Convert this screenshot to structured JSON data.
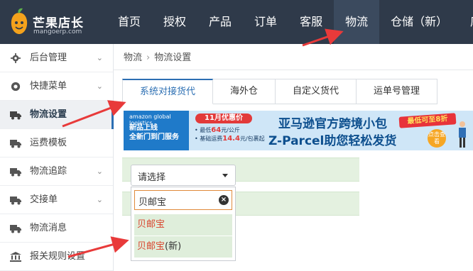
{
  "app": {
    "logo_title": "芒果店长",
    "logo_sub": "mangoerp.com"
  },
  "topnav": {
    "items": [
      {
        "label": "首页"
      },
      {
        "label": "授权"
      },
      {
        "label": "产品"
      },
      {
        "label": "订单"
      },
      {
        "label": "客服"
      },
      {
        "label": "物流",
        "active": true
      },
      {
        "label": "仓储（新）"
      },
      {
        "label": "库"
      }
    ]
  },
  "sidebar": {
    "items": [
      {
        "label": "后台管理",
        "icon": "gear-icon",
        "has_chevron": true
      },
      {
        "label": "快捷菜单",
        "icon": "target-icon",
        "has_chevron": true
      },
      {
        "label": "物流设置",
        "icon": "truck-icon",
        "active": true
      },
      {
        "label": "运费模板",
        "icon": "truck-icon"
      },
      {
        "label": "物流追踪",
        "icon": "truck-icon",
        "has_chevron": true
      },
      {
        "label": "交接单",
        "icon": "truck-icon",
        "has_chevron": true
      },
      {
        "label": "物流消息",
        "icon": "truck-icon"
      },
      {
        "label": "报关规则设置",
        "icon": "bank-icon"
      }
    ]
  },
  "breadcrumb": {
    "root": "物流",
    "current": "物流设置"
  },
  "tabs": [
    {
      "label": "系统对接货代",
      "active": true
    },
    {
      "label": "海外仓"
    },
    {
      "label": "自定义货代"
    },
    {
      "label": "运单号管理"
    }
  ],
  "banner": {
    "amazon": "amazon global logistics",
    "new_line1": "新品上线",
    "new_line2": "全新门到门服务",
    "offer": "11月优惠价",
    "price_line1_prefix": "• 最低",
    "price_line1_value": "64",
    "price_line1_suffix": "元/公斤",
    "price_line2_prefix": "• 基础运费",
    "price_line2_value": "14.4",
    "price_line2_suffix": "元/包裹起",
    "headline1": "亚马逊官方跨境小包",
    "headline2": "Z-Parcel助您轻松发货",
    "promo": "最低可至8折",
    "button": "点击查看"
  },
  "select": {
    "placeholder": "请选择",
    "search_value": "贝邮宝",
    "options": [
      {
        "highlight": "贝邮宝",
        "rest": ""
      },
      {
        "highlight": "贝邮宝",
        "rest": "(新)"
      }
    ]
  },
  "colors": {
    "topbar": "#2f3a4a",
    "accent": "#2c6fb3",
    "arrow": "#e83a3a",
    "option_bg": "#dfeedb"
  }
}
